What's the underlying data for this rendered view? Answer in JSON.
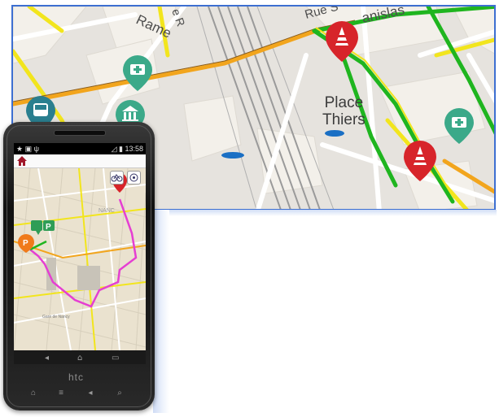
{
  "map": {
    "street_labels": [
      "Rame",
      "Rue S",
      "anislas",
      "e R",
      "Place",
      "Thiers"
    ],
    "colors": {
      "traffic_green": "#1fb51f",
      "traffic_yellow": "#f2e51d",
      "traffic_orange": "#f2a51d",
      "alert_red": "#d7242a",
      "hospital_teal": "#3ba989",
      "route_magenta": "#e53fd2",
      "frame_blue": "#3d6fd1"
    },
    "icons": [
      "hospital-icon",
      "bus-icon",
      "museum-icon",
      "roadwork-icon",
      "car-icon"
    ]
  },
  "phone": {
    "status": {
      "left_icons": "★ ▣ ψ",
      "signal": "◿ ▮",
      "time": "13:58"
    },
    "brand": "htc",
    "nav_keys": [
      "◂",
      "⌂",
      "▭"
    ],
    "hw_keys": [
      "⌂",
      "≡",
      "◂",
      "⌕"
    ],
    "map_markers": [
      "P",
      "P"
    ],
    "mini_labels": [
      "NANC",
      "Gare de Nancy"
    ]
  }
}
